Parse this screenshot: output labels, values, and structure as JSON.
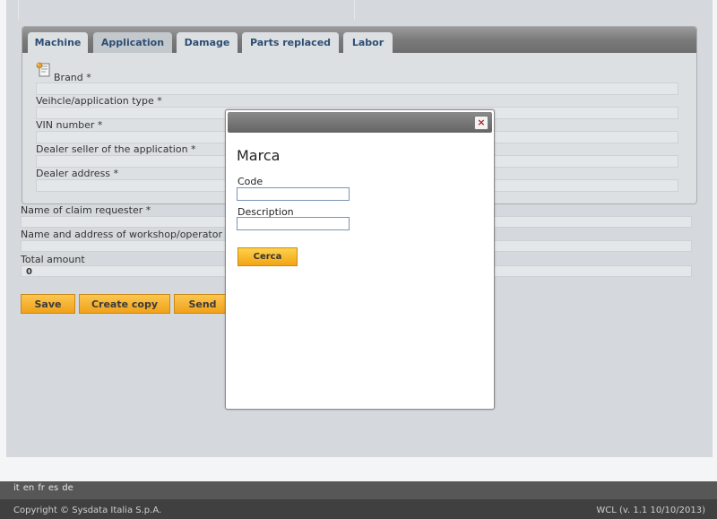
{
  "tabs": [
    {
      "label": "Machine"
    },
    {
      "label": "Application"
    },
    {
      "label": "Damage"
    },
    {
      "label": "Parts replaced"
    },
    {
      "label": "Labor"
    }
  ],
  "form": {
    "brand_label": "Brand *",
    "vehicle_type_label": "Veihcle/application type *",
    "vin_label": "VIN number *",
    "dealer_seller_label": "Dealer seller of the application *",
    "dealer_address_label": "Dealer address *",
    "claim_requester_label": "Name of claim requester *",
    "workshop_label": "Name and address of workshop/operator w",
    "total_amount_label": "Total amount",
    "total_amount_value": "0"
  },
  "buttons": {
    "save": "Save",
    "create_copy": "Create copy",
    "send": "Send"
  },
  "modal": {
    "title": "Marca",
    "close_symbol": "×",
    "code_label": "Code",
    "code_value": "",
    "description_label": "Description",
    "description_value": "",
    "search_button": "Cerca"
  },
  "footer": {
    "languages": [
      "it",
      "en",
      "fr",
      "es",
      "de"
    ],
    "copyright": "Copyright © Sysdata Italia S.p.A.",
    "version": "WCL (v. 1.1 10/10/2013)"
  },
  "colors": {
    "tab_text": "#2d4e73",
    "button_orange": "#f0a11a",
    "close_red": "#b02020"
  }
}
